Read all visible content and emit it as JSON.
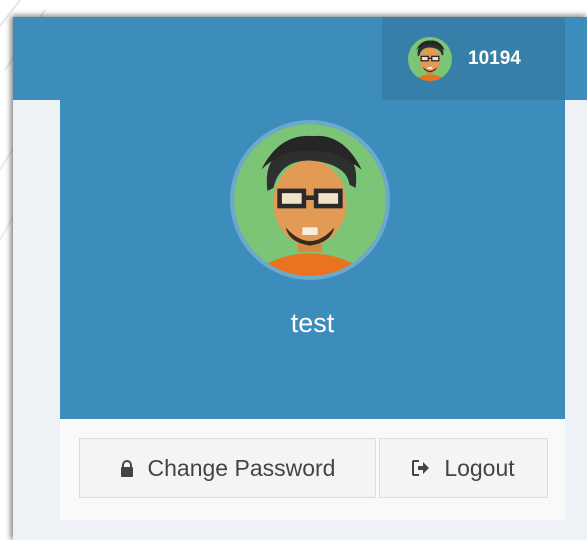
{
  "topbar": {
    "user_menu": {
      "username": "10194",
      "avatar_icon": "user-avatar-icon"
    }
  },
  "user_panel": {
    "display_name": "test",
    "avatar_icon": "user-avatar-icon"
  },
  "footer": {
    "change_password_label": "Change Password",
    "change_password_icon": "lock-icon",
    "logout_label": "Logout",
    "logout_icon": "sign-out-icon"
  },
  "colors": {
    "primary": "#3c8dbc",
    "primary_dark": "#367fa9",
    "button_bg": "#f4f4f4",
    "button_text": "#444444"
  }
}
